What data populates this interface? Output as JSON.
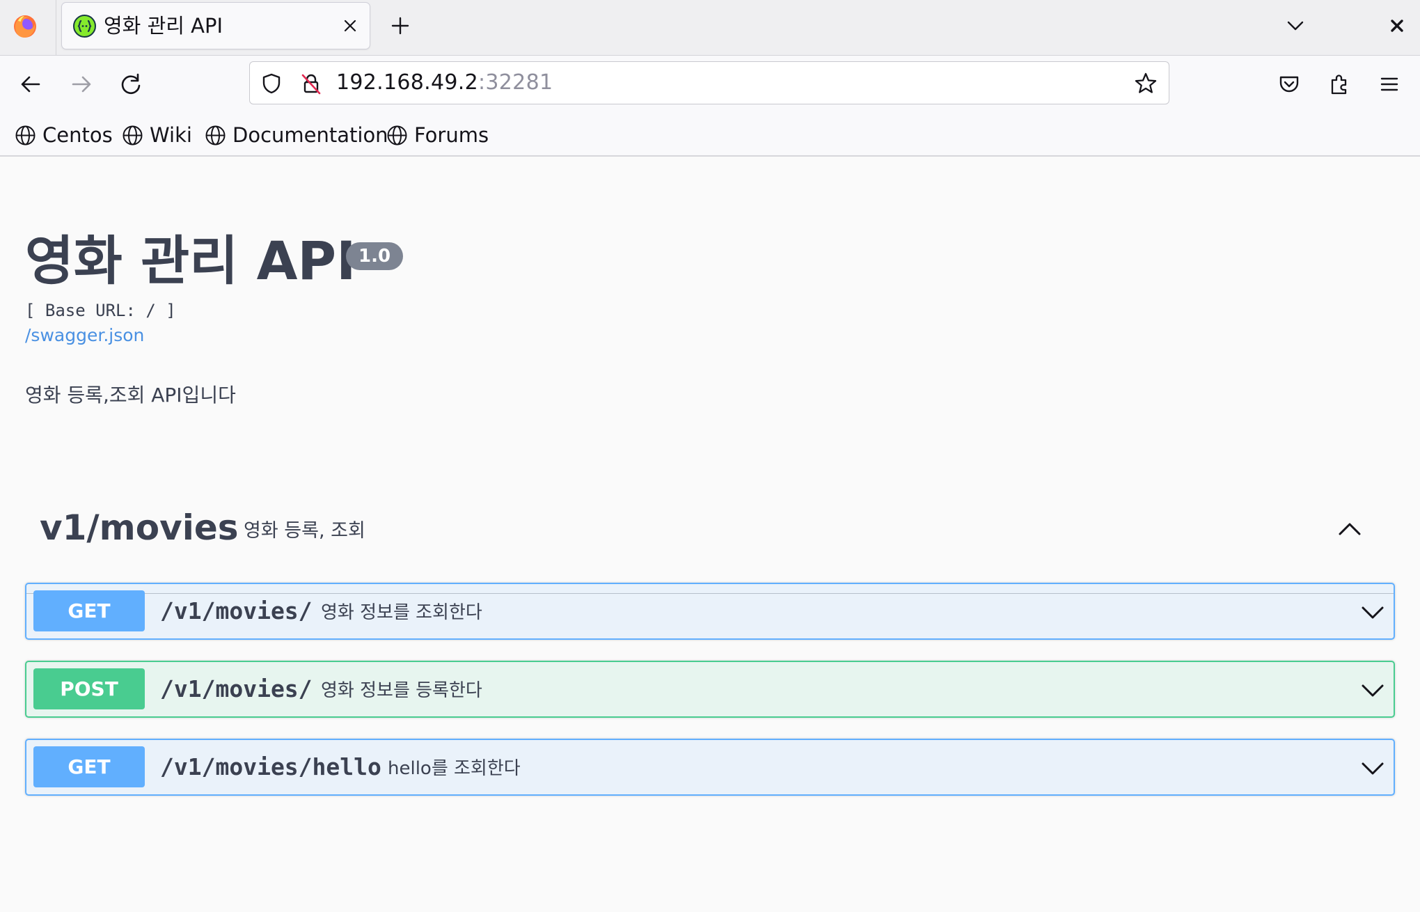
{
  "browser": {
    "tab_title": "영화 관리 API",
    "url_host": "192.168.49.2",
    "url_port": ":32281",
    "bookmarks": [
      {
        "label": "Centos"
      },
      {
        "label": "Wiki"
      },
      {
        "label": "Documentation"
      },
      {
        "label": "Forums"
      }
    ]
  },
  "info": {
    "title": "영화 관리 API",
    "version": "1.0",
    "base_url": "[ Base URL: / ]",
    "spec_link": "/swagger.json",
    "description": "영화 등록,조회 API입니다"
  },
  "tag": {
    "name": "v1/movies",
    "description": "영화 등록, 조회"
  },
  "operations": [
    {
      "method": "GET",
      "path": "/v1/movies/",
      "summary": "영화 정보를 조회한다"
    },
    {
      "method": "POST",
      "path": "/v1/movies/",
      "summary": "영화 정보를 등록한다"
    },
    {
      "method": "GET",
      "path": "/v1/movies/hello",
      "summary": "hello를 조회한다"
    }
  ],
  "colors": {
    "get": "#61affe",
    "post": "#49cc90",
    "link": "#4990e2",
    "text": "#3b4151"
  }
}
